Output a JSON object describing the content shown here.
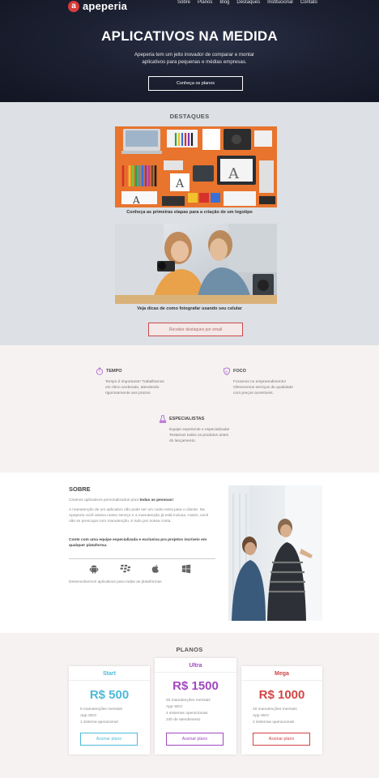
{
  "header": {
    "logo_letter": "a",
    "logo_text": "apeperia",
    "nav": [
      "Sobre",
      "Planos",
      "Blog",
      "Destaques",
      "Institucional",
      "Contato"
    ]
  },
  "hero": {
    "title": "APLICATIVOS NA MEDIDA",
    "subtitle_line1": "Apeperia tem um jeito inovador de comparar e montar",
    "subtitle_line2": "aplicativos para pequenas e médias empresas.",
    "cta": "Conheça os planos"
  },
  "destaques": {
    "title": "DESTAQUES",
    "items": [
      {
        "caption": "Conheça as primeiras etapas para a criação de um logotipo"
      },
      {
        "caption": "Veja dicas de como fotografar usando seu celular"
      }
    ],
    "cta": "Receber destaques por email"
  },
  "features": [
    {
      "name": "TEMPO",
      "icon": "stopwatch-icon",
      "lines": [
        "Tempo é importante! Trabalhamos",
        "em ritmo acelerado, atendendo",
        "rigorosamente aos prazos."
      ]
    },
    {
      "name": "FOCO",
      "icon": "shield-icon",
      "lines": [
        "Focamos no empreendimento!",
        "Oferecemos serviços de qualidade",
        "com preços acessíveis."
      ]
    },
    {
      "name": "ESPECIALISTAS",
      "icon": "flask-icon",
      "lines": [
        "Equipe experiente e especializada!",
        "Testamos todos os produtos antes",
        "do lançamento."
      ]
    }
  ],
  "sobre": {
    "title": "SOBRE",
    "p1_normal": "Criamos aplicativos personalizados para ",
    "p1_bold": "todas as pessoas!",
    "p2": "A manutenção de um aplicativo não pode ser um custo extra para o cliente. Na Apeperia você assina nosso serviço e a manutenção já está inclusa. Assim, você não se preocupa com manutenção, é tudo por nossa conta.",
    "p3": "Conte com uma equipe especializada e exclusiva pra projetos incríveis em qualquer plataforma.",
    "platforms": [
      "android-icon",
      "blackberry-icon",
      "apple-icon",
      "windows-icon"
    ],
    "footer": "Desenvolvemos aplicativos para todas as plataformas"
  },
  "planos": {
    "title": "PLANOS",
    "plans": [
      {
        "name": "Start",
        "price": "R$ 500",
        "color": "#4fb8d8",
        "features": [
          "5 manutenções mensais",
          "App SEO",
          "1 sistema operacional"
        ],
        "cta": "Assinar plano"
      },
      {
        "name": "Ultra",
        "price": "R$ 1500",
        "color": "#a049c0",
        "features": [
          "20 manutenções mensais",
          "App SEO",
          "4 sistemas operacionais",
          "24h de atendimento"
        ],
        "cta": "Assinar plano"
      },
      {
        "name": "Mega",
        "price": "R$ 1000",
        "color": "#d24545",
        "features": [
          "10 manutenções mensais",
          "App SEO",
          "2 sistemas operacionais"
        ],
        "cta": "Assinar plano"
      }
    ]
  },
  "colors": {
    "accent_red": "#d83b3b",
    "feature_icon": "#b06bd0",
    "hero_bg": "#1c2132"
  }
}
